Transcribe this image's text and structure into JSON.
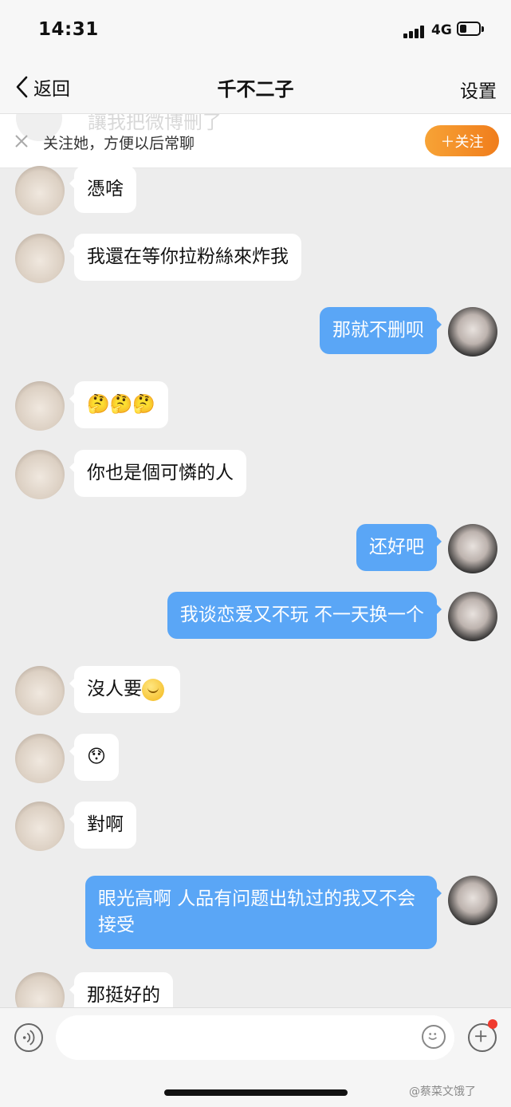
{
  "status_bar": {
    "time": "14:31",
    "network": "4G",
    "battery_level": 0.3
  },
  "nav": {
    "back_label": "返回",
    "title": "千不二子",
    "settings_label": "设置"
  },
  "banner": {
    "ghost_text": "讓我把微博刪了",
    "text": "关注她，方便以后常聊",
    "follow_label": "＋关注",
    "follow_color": "#f28a27"
  },
  "messages": [
    {
      "side": "in",
      "text": "憑啥"
    },
    {
      "side": "in",
      "text": "我還在等你拉粉絲來炸我"
    },
    {
      "side": "out",
      "text": "那就不删呗"
    },
    {
      "side": "in",
      "text": "🤔🤔🤔"
    },
    {
      "side": "in",
      "text": "你也是個可憐的人"
    },
    {
      "side": "out",
      "text": "还好吧"
    },
    {
      "side": "out",
      "text": "我谈恋爱又不玩 不一天换一个"
    },
    {
      "side": "in",
      "text": "沒人要"
    },
    {
      "side": "in",
      "text": "😯"
    },
    {
      "side": "in",
      "text": "對啊"
    },
    {
      "side": "out",
      "text": "眼光高啊 人品有问题出轨过的我又不会接受"
    },
    {
      "side": "in",
      "text": "那挺好的"
    }
  ],
  "input": {
    "placeholder": ""
  },
  "watermark": "@蔡菜文饿了",
  "colors": {
    "outgoing_bubble": "#5aa6f6",
    "incoming_bubble": "#ffffff",
    "background": "#ededed"
  }
}
